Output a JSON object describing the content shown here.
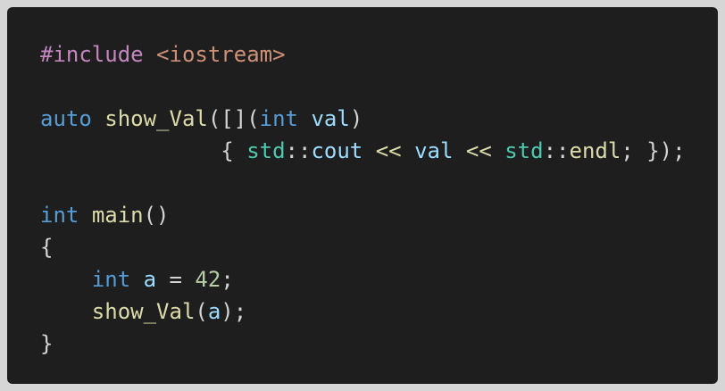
{
  "editor": {
    "language": "cpp",
    "theme_colors": {
      "background": "#1e1e1e",
      "page": "#d6d6d6",
      "preprocessor": "#c586c0",
      "string": "#ce9178",
      "keyword": "#569cd6",
      "function": "#dcdcaa",
      "variable": "#9cdcfe",
      "namespace": "#4ec9b0",
      "number": "#b5cea8",
      "punctuation": "#d4d4d4"
    },
    "lines": [
      [
        {
          "t": "#include",
          "k": "pre"
        },
        {
          "t": " ",
          "k": "pun"
        },
        {
          "t": "<iostream>",
          "k": "str"
        }
      ],
      [],
      [
        {
          "t": "auto",
          "k": "kw"
        },
        {
          "t": " ",
          "k": "pun"
        },
        {
          "t": "show_Val",
          "k": "fn"
        },
        {
          "t": "([](",
          "k": "pun"
        },
        {
          "t": "int",
          "k": "kw"
        },
        {
          "t": " ",
          "k": "pun"
        },
        {
          "t": "val",
          "k": "var"
        },
        {
          "t": ")",
          "k": "pun"
        }
      ],
      [
        {
          "t": "              { ",
          "k": "pun"
        },
        {
          "t": "std",
          "k": "ns"
        },
        {
          "t": "::",
          "k": "pun"
        },
        {
          "t": "cout",
          "k": "var"
        },
        {
          "t": " ",
          "k": "pun"
        },
        {
          "t": "<<",
          "k": "fn"
        },
        {
          "t": " ",
          "k": "pun"
        },
        {
          "t": "val",
          "k": "var"
        },
        {
          "t": " ",
          "k": "pun"
        },
        {
          "t": "<<",
          "k": "fn"
        },
        {
          "t": " ",
          "k": "pun"
        },
        {
          "t": "std",
          "k": "ns"
        },
        {
          "t": "::",
          "k": "pun"
        },
        {
          "t": "endl",
          "k": "fn"
        },
        {
          "t": "; });",
          "k": "pun"
        }
      ],
      [],
      [
        {
          "t": "int",
          "k": "kw"
        },
        {
          "t": " ",
          "k": "pun"
        },
        {
          "t": "main",
          "k": "fn"
        },
        {
          "t": "()",
          "k": "pun"
        }
      ],
      [
        {
          "t": "{",
          "k": "pun"
        }
      ],
      [
        {
          "t": "    ",
          "k": "pun"
        },
        {
          "t": "int",
          "k": "kw"
        },
        {
          "t": " ",
          "k": "pun"
        },
        {
          "t": "a",
          "k": "var"
        },
        {
          "t": " = ",
          "k": "pun"
        },
        {
          "t": "42",
          "k": "num"
        },
        {
          "t": ";",
          "k": "pun"
        }
      ],
      [
        {
          "t": "    ",
          "k": "pun"
        },
        {
          "t": "show_Val",
          "k": "fn"
        },
        {
          "t": "(",
          "k": "pun"
        },
        {
          "t": "a",
          "k": "var"
        },
        {
          "t": ");",
          "k": "pun"
        }
      ],
      [
        {
          "t": "}",
          "k": "pun"
        }
      ]
    ]
  }
}
